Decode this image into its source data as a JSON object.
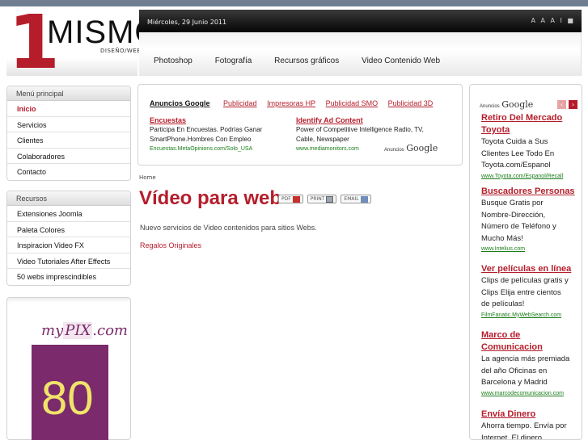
{
  "header": {
    "logo": {
      "number": "1",
      "brand": "MISMO",
      "subtitle": "DISEÑO/WEB"
    },
    "date": "Miércoles, 29 Junio 2011",
    "font_size_controls": "A A A I ■",
    "nav": [
      "Photoshop",
      "Fotografía",
      "Recursos gráficos",
      "Video Contenido Web"
    ]
  },
  "menu_principal": {
    "title": "Menú principal",
    "items": [
      "Inicio",
      "Servicios",
      "Clientes",
      "Colaboradores",
      "Contacto"
    ]
  },
  "recursos": {
    "title": "Recursos",
    "items": [
      "Extensiones Joomla",
      "Paleta Colores",
      "Inspiracion Video FX",
      "Video Tutoriales After Effects",
      "50 webs imprescindibles"
    ]
  },
  "left_ad": {
    "brand_pre": "my",
    "brand_mid": "PIX",
    "brand_post": ".com",
    "number": "80"
  },
  "mid_ad": {
    "ads_label": "Anuncios Google",
    "links": [
      "Publicidad",
      "Impresoras HP",
      "Publicidad SMO",
      "Publicidad 3D"
    ],
    "ad1": {
      "title": "Encuestas",
      "lines": [
        "Participa En Encuestas. Podrías Ganar",
        "SmartPhone.Hombres Con Empleo"
      ],
      "url": "Encuestas.MetaOpinions.com/Solo_USA"
    },
    "ad2": {
      "title": "Identify Ad Content",
      "lines": [
        "Power of Competitive Intelligence Radio, TV,",
        "Cable, Newspaper"
      ],
      "url": "www.mediamonitors.com"
    },
    "by_small": "Anuncios",
    "by_google": "Google"
  },
  "content": {
    "breadcrumb": "Home",
    "title": "Vídeo para web",
    "icons": {
      "pdf": "PDF",
      "print": "PRINT",
      "email": "EMAIL"
    },
    "intro": "Nuevo servicios de Video contenidos para sitios Webs.",
    "link": "Regalos Originales"
  },
  "right_ads": {
    "by_small": "Anuncios",
    "by_google": "Google",
    "ads": [
      {
        "title1": "Retiro Del Mercado",
        "title2": "Toyota",
        "lines": [
          "Toyota Cuida a Sus",
          "Clientes Lee Todo En",
          "Toyota.com/Espanol"
        ],
        "url": "www.Toyota.com/Espanol/Recall"
      },
      {
        "title1": "Buscadores Personas",
        "title2": "",
        "lines": [
          "Busque Gratis por",
          "Nombre-Dirección,",
          "Número de Teléfono y",
          "Mucho Más!"
        ],
        "url": "www.Intelius.com"
      },
      {
        "title1": "Ver películas en línea",
        "title2": "",
        "lines": [
          "Clips de películas gratis y",
          "Clips Elija entre cientos",
          "de películas!"
        ],
        "url": "FilmFanatic.MyWebSearch.com"
      },
      {
        "title1": "Marco de",
        "title2": "Comunicacion",
        "lines": [
          "La agencia más premiada",
          "del año Oficinas en",
          "Barcelona y Madrid"
        ],
        "url": "www.marcodecomunicacion.com"
      },
      {
        "title1": "Envía Dinero",
        "title2": "",
        "lines": [
          "Ahorra tiempo. Envía por",
          "Internet. El dinero"
        ],
        "url": ""
      }
    ]
  }
}
